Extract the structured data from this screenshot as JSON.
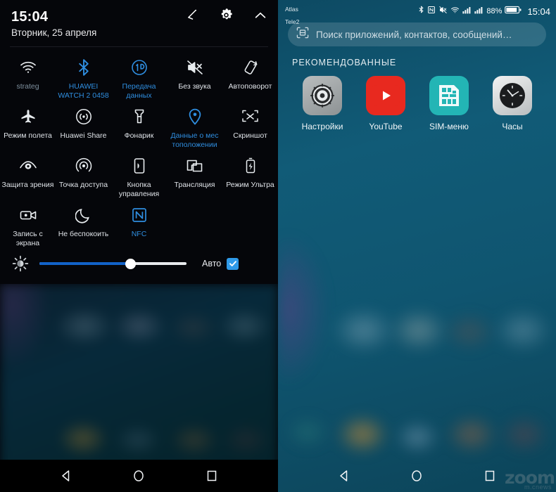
{
  "quick_settings": {
    "time": "15:04",
    "date": "Вторник, 25 апреля",
    "header_icons": [
      {
        "name": "edit-icon",
        "label": "Изменить"
      },
      {
        "name": "gear-icon",
        "label": "Настройки"
      },
      {
        "name": "chevron-up-icon",
        "label": "Свернуть"
      }
    ],
    "tiles": [
      {
        "label": "strateg",
        "icon": "wifi-icon",
        "state": "dim"
      },
      {
        "label": "HUAWEI WATCH 2 0458",
        "icon": "bluetooth-icon",
        "state": "on"
      },
      {
        "label": "Передача данных",
        "icon": "data-transfer-icon",
        "state": "on"
      },
      {
        "label": "Без звука",
        "icon": "mute-icon",
        "state": "off"
      },
      {
        "label": "Автоповорот",
        "icon": "auto-rotate-icon",
        "state": "off"
      },
      {
        "label": "Режим полета",
        "icon": "airplane-icon",
        "state": "off"
      },
      {
        "label": "Huawei Share",
        "icon": "huawei-share-icon",
        "state": "off"
      },
      {
        "label": "Фонарик",
        "icon": "flashlight-icon",
        "state": "off"
      },
      {
        "label": "Данные о мес тоположении",
        "icon": "location-pin-icon",
        "state": "on"
      },
      {
        "label": "Скриншот",
        "icon": "screenshot-icon",
        "state": "off"
      },
      {
        "label": "Защита зрения",
        "icon": "eye-comfort-icon",
        "state": "off"
      },
      {
        "label": "Точка доступа",
        "icon": "hotspot-icon",
        "state": "off"
      },
      {
        "label": "Кнопка управления",
        "icon": "nav-dock-icon",
        "state": "off"
      },
      {
        "label": "Трансляция",
        "icon": "cast-icon",
        "state": "off"
      },
      {
        "label": "Режим Ультра",
        "icon": "ultra-power-icon",
        "state": "off"
      },
      {
        "label": "Запись с экрана",
        "icon": "screen-record-icon",
        "state": "off"
      },
      {
        "label": "Не беспокоить",
        "icon": "moon-icon",
        "state": "off"
      },
      {
        "label": "NFC",
        "icon": "nfc-icon",
        "state": "on"
      }
    ],
    "brightness": {
      "icon": "brightness-icon",
      "value_percent": 62,
      "auto_label": "Авто",
      "auto_checked": true,
      "fill_color": "#1262c8",
      "check_color": "#2f9ae8"
    },
    "accent_color": "#2f8ee0"
  },
  "home": {
    "status_bar": {
      "carrier_line1": "Atlas",
      "carrier_line2": "Tele2",
      "icons": [
        "bluetooth-icon",
        "nfc-icon",
        "mute-icon",
        "wifi-icon",
        "signal-bars-icon",
        "signal-bars-icon"
      ],
      "battery_percent": "88%",
      "battery_icon": "battery-icon",
      "time": "15:04"
    },
    "search": {
      "icon": "scan-icon",
      "placeholder": "Поиск приложений, контактов, сообщений…"
    },
    "section_title": "РЕКОМЕНДОВАННЫЕ",
    "apps": [
      {
        "label": "Настройки",
        "icon": "settings-app-icon",
        "color": "#9ea3a5"
      },
      {
        "label": "YouTube",
        "icon": "youtube-app-icon",
        "color": "#e8291f"
      },
      {
        "label": "SIM-меню",
        "icon": "sim-menu-app-icon",
        "color": "#23b5b5"
      },
      {
        "label": "Часы",
        "icon": "clock-app-icon",
        "color": "#d4d7d8"
      }
    ]
  },
  "navbar": {
    "back_label": "Назад",
    "home_label": "Главный экран",
    "recents_label": "Последние приложения"
  },
  "watermark": {
    "text": "zoom",
    "subtext": "m.cnews"
  }
}
